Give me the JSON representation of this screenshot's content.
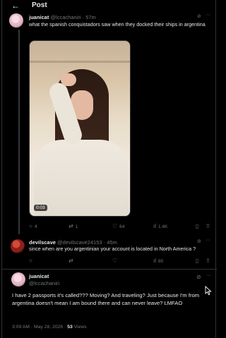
{
  "header": {
    "title": "Post"
  },
  "tweet1": {
    "name": "juanicat",
    "handle": "@lccachaniri",
    "time": "· 57m",
    "text": "what the spanish conquistadors saw when they docked their ships in argentina",
    "video_duration": "0:03",
    "replies": "4",
    "retweets": "1",
    "likes": "64",
    "views": "1.4K"
  },
  "tweet2": {
    "name": "devilscave",
    "handle": "@devilscave24153",
    "time": "· 45m",
    "text": "since when are you argentinian your account is located in North America ?",
    "replies": "",
    "retweets": "",
    "likes": "",
    "views": "80"
  },
  "tweet3": {
    "name": "juanicat",
    "handle": "@lccachaniri",
    "text": "I have 2 passports it's called??? Moving? And traveling? Just because I'm from argentina doesn't mean I am bound there and can never leave? LMFAO",
    "timestamp": "3:09 AM · May 28, 2026 ·",
    "view_count": "53",
    "views_label": "Views"
  },
  "icons": {
    "back": "arrow-left-icon",
    "reply": "speech-bubble-icon",
    "retweet": "retweet-icon",
    "like": "heart-icon",
    "views": "bar-chart-icon",
    "bookmark": "bookmark-icon",
    "share": "share-icon",
    "grok": "grok-icon",
    "more": "more-icon"
  },
  "colors": {
    "background": "#000000",
    "text": "#e7e9ea",
    "muted": "#71767b",
    "border": "#2f3336"
  }
}
